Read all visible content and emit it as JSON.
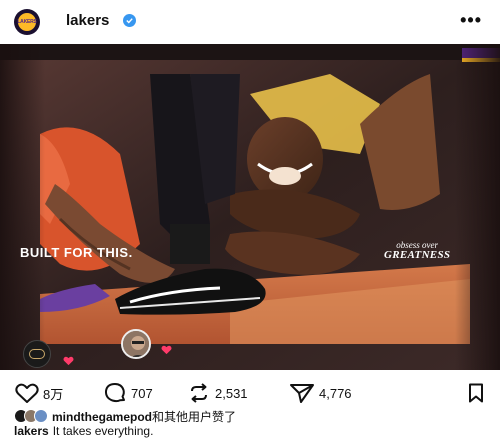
{
  "header": {
    "username": "lakers",
    "avatar_text": "LAKERS",
    "more_label": "•••"
  },
  "post": {
    "headline": "BUILT FOR THIS.",
    "brand_top": "obsess over",
    "brand_bottom": "GREATNESS"
  },
  "actions": {
    "likes_count": "8万",
    "comments_count": "707",
    "reposts_count": "2,531",
    "shares_count": "4,776"
  },
  "likes": {
    "liker": "mindthegamepod",
    "suffix": "和其他用户赞了"
  },
  "caption": {
    "author": "lakers",
    "text": "It takes everything."
  },
  "colors": {
    "accent_purple": "#552583",
    "accent_gold": "#fdb927",
    "verified_blue": "#3797f0",
    "like_heart": "#ff3b6a"
  }
}
